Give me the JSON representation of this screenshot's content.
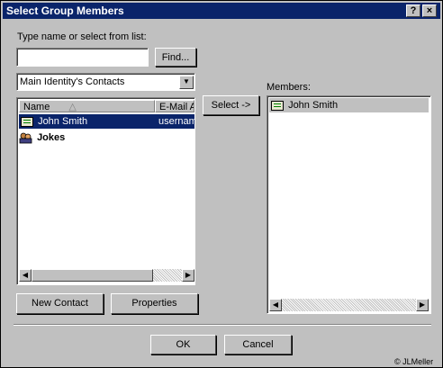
{
  "window": {
    "title": "Select Group Members",
    "help_label": "?",
    "close_label": "×"
  },
  "search": {
    "label": "Type name or select from list:",
    "value": "",
    "find_label": "Find..."
  },
  "source": {
    "selected": "Main Identity's Contacts"
  },
  "contacts": {
    "columns": [
      "Name",
      "E-Mail A"
    ],
    "rows": [
      {
        "name": "John Smith",
        "email": "usernam",
        "icon": "contact-card-icon",
        "selected": true
      },
      {
        "name": "Jokes",
        "email": "",
        "icon": "group-icon",
        "selected": false
      }
    ]
  },
  "select_label": "Select ->",
  "members": {
    "label": "Members:",
    "items": [
      {
        "name": "John Smith",
        "icon": "contact-card-icon"
      }
    ]
  },
  "buttons": {
    "new_contact": "New Contact",
    "properties": "Properties",
    "ok": "OK",
    "cancel": "Cancel"
  },
  "footer": {
    "credit": "© JLMeller"
  },
  "colors": {
    "titlebar": "#0a246a",
    "selection": "#0a246a",
    "face": "#c0c0c0"
  }
}
